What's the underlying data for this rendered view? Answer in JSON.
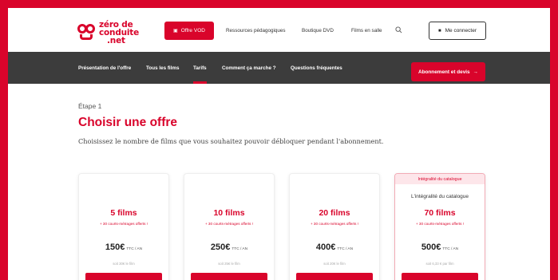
{
  "colors": {
    "brand": "#d9042b",
    "dark_nav": "#3c3c3c"
  },
  "header": {
    "logo": {
      "line1": "zéro de",
      "line2": "conduite",
      "line3": ".net"
    },
    "offre_vod": "Offre VOD",
    "nav": [
      "Ressources pédagogiques",
      "Boutique DVD",
      "Films en salle"
    ],
    "search_icon": "search-icon",
    "connect": "Me connecter"
  },
  "subnav": {
    "tabs": [
      "Présentation de l'offre",
      "Tous les films",
      "Tarifs",
      "Comment ça marche ?",
      "Questions fréquentes"
    ],
    "active": "Tarifs",
    "cta": "Abonnement et devis"
  },
  "content": {
    "step": "Étape 1",
    "title": "Choisir une offre",
    "subtitle": "Choisissez le nombre de films que vous souhaitez pouvoir débloquer pendant l'abonnement."
  },
  "offers": [
    {
      "name": "5 films",
      "bonus": "+ 30 courts-métrages offerts !",
      "price": "150€",
      "unit": "TTC / AN",
      "per_film": "soit 30€ le film"
    },
    {
      "name": "10 films",
      "bonus": "+ 30 courts-métrages offerts !",
      "price": "250€",
      "unit": "TTC / AN",
      "per_film": "soit 25€ le film"
    },
    {
      "name": "20 films",
      "bonus": "+ 30 courts-métrages offerts !",
      "price": "400€",
      "unit": "TTC / AN",
      "per_film": "soit 20€ le film"
    },
    {
      "banner": "Intégralité du catalogue",
      "desc": "L'intégralité du catalogue",
      "name": "70 films",
      "bonus": "+ 30 courts-métrages offerts !",
      "price": "500€",
      "unit": "TTC / AN",
      "per_film": "soit 6,33 € par film"
    }
  ]
}
